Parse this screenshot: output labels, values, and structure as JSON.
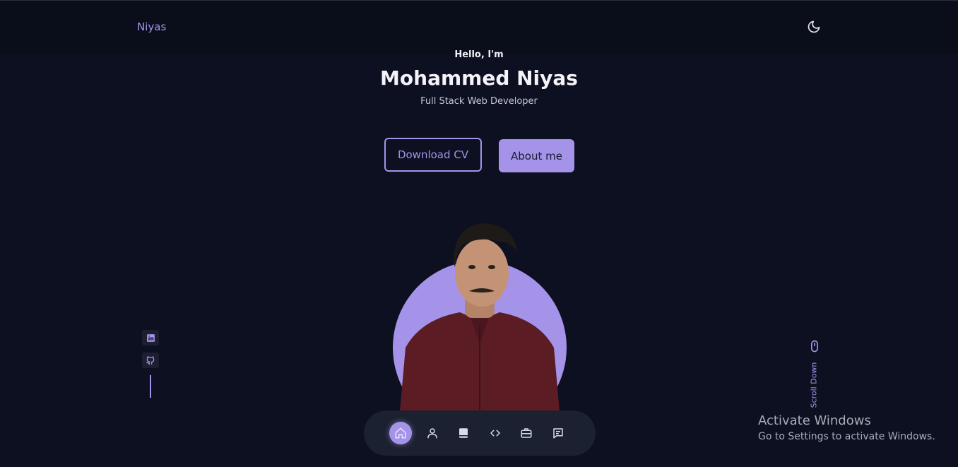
{
  "header": {
    "logo": "Niyas",
    "theme_toggle_icon": "moon-icon"
  },
  "hero": {
    "greeting": "Hello, I'm",
    "name": "Mohammed Niyas",
    "role": "Full Stack Web Developer",
    "download_cv_label": "Download CV",
    "about_label": "About me",
    "accent_color": "#a593ea",
    "background_color": "#0c1020"
  },
  "social": [
    {
      "icon": "linkedin-icon"
    },
    {
      "icon": "github-icon"
    }
  ],
  "scroll": {
    "label": "Scroll Down",
    "icon": "mouse-icon"
  },
  "bottom_nav": {
    "items": [
      {
        "icon": "home-icon",
        "active": true
      },
      {
        "icon": "user-icon",
        "active": false
      },
      {
        "icon": "book-icon",
        "active": false
      },
      {
        "icon": "code-icon",
        "active": false
      },
      {
        "icon": "briefcase-icon",
        "active": false
      },
      {
        "icon": "message-icon",
        "active": false
      }
    ]
  },
  "watermark": {
    "title": "Activate Windows",
    "subtitle": "Go to Settings to activate Windows."
  }
}
